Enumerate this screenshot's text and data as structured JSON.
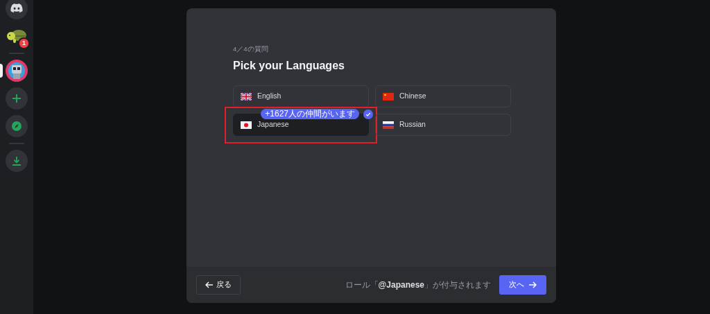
{
  "sidebar": {
    "items": [
      {
        "kind": "home",
        "selected": false
      },
      {
        "kind": "server",
        "selected": false,
        "badge": "1"
      },
      {
        "kind": "server-bot",
        "selected": true
      },
      {
        "kind": "add",
        "selected": false
      },
      {
        "kind": "explore",
        "selected": false
      },
      {
        "kind": "download",
        "selected": false
      }
    ]
  },
  "dialog": {
    "step": "4／4の質問",
    "title": "Pick your Languages",
    "options": [
      {
        "label": "English",
        "kind": "uk",
        "selected": false,
        "highlighted": false
      },
      {
        "label": "Chinese",
        "kind": "cn",
        "selected": false,
        "highlighted": false
      },
      {
        "label": "Japanese",
        "kind": "jp",
        "selected": true,
        "highlighted": true,
        "badge": "+1627人の仲間がいます"
      },
      {
        "label": "Russian",
        "kind": "ru",
        "selected": false,
        "highlighted": false
      }
    ],
    "back_button": "戻る",
    "role_note": "ロール「**@Japanese**」が付与されます",
    "next_button": "次へ"
  }
}
